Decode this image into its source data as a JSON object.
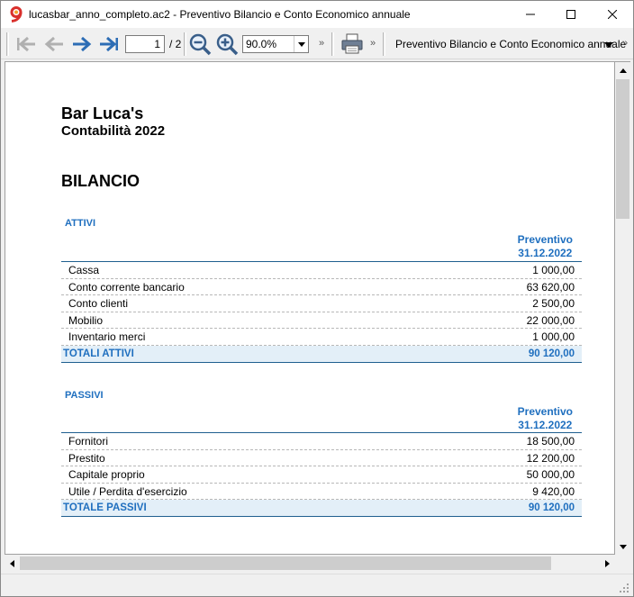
{
  "window": {
    "title": "lucasbar_anno_completo.ac2 - Preventivo Bilancio e Conto Economico annuale"
  },
  "toolbar": {
    "page_current": "1",
    "page_total": "/ 2",
    "zoom": "90.0%",
    "report_select": "Preventivo Bilancio e Conto Economico annuale",
    "overflow_chevron": "»"
  },
  "report": {
    "company": "Bar Luca's",
    "subtitle": "Contabilità 2022",
    "title": "BILANCIO",
    "attivi": {
      "heading": "ATTIVI",
      "column_line1": "Preventivo",
      "column_line2": "31.12.2022",
      "rows": [
        {
          "label": "Cassa",
          "value": "1 000,00"
        },
        {
          "label": "Conto corrente bancario",
          "value": "63 620,00"
        },
        {
          "label": "Conto clienti",
          "value": "2 500,00"
        },
        {
          "label": "Mobilio",
          "value": "22 000,00"
        },
        {
          "label": "Inventario merci",
          "value": "1 000,00"
        }
      ],
      "total_label": "TOTALI ATTIVI",
      "total_value": "90 120,00"
    },
    "passivi": {
      "heading": "PASSIVI",
      "column_line1": "Preventivo",
      "column_line2": "31.12.2022",
      "rows": [
        {
          "label": "Fornitori",
          "value": "18 500,00"
        },
        {
          "label": "Prestito",
          "value": "12 200,00"
        },
        {
          "label": "Capitale proprio",
          "value": "50 000,00"
        },
        {
          "label": "Utile / Perdita d'esercizio",
          "value": "9 420,00"
        }
      ],
      "total_label": "TOTALE PASSIVI",
      "total_value": "90 120,00"
    }
  },
  "colors": {
    "accent": "#1f6fbf",
    "total_row_bg": "#e3eff8",
    "app_icon": "#d9302c"
  },
  "icons": [
    "app-icon",
    "minimize-icon",
    "maximize-icon",
    "close-icon",
    "first-page-icon",
    "previous-page-icon",
    "next-page-icon",
    "last-page-icon",
    "zoom-out-icon",
    "zoom-in-icon",
    "print-icon"
  ]
}
